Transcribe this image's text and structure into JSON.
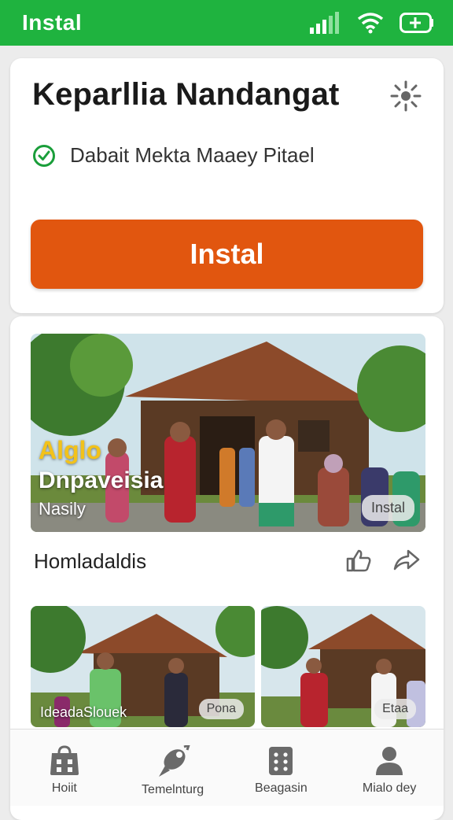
{
  "status_bar": {
    "title": "Instal"
  },
  "app": {
    "title": "Keparllia Nandangat",
    "verified_text": "Dabait Mekta Maaey Pitael",
    "install_label": "Instal"
  },
  "hero": {
    "overlay_line1": "Alglo",
    "overlay_line2": "Dnpaveisia",
    "overlay_line3": "Nasily",
    "badge": "Instal"
  },
  "caption": {
    "title": "Homladaldis"
  },
  "thumbnails": [
    {
      "label": "IdeadaSlouek",
      "badge": "Pona"
    },
    {
      "label": "",
      "badge": "Etaa"
    }
  ],
  "bottom_nav": [
    {
      "label": "Hoiit",
      "icon": "store-icon"
    },
    {
      "label": "Temelnturg",
      "icon": "rocket-icon"
    },
    {
      "label": "Beagasin",
      "icon": "apps-icon"
    },
    {
      "label": "Mialo dey",
      "icon": "profile-icon"
    }
  ],
  "colors": {
    "status_green": "#1fb33f",
    "accent_orange": "#e1560f",
    "verified_green": "#1a9e3a"
  }
}
